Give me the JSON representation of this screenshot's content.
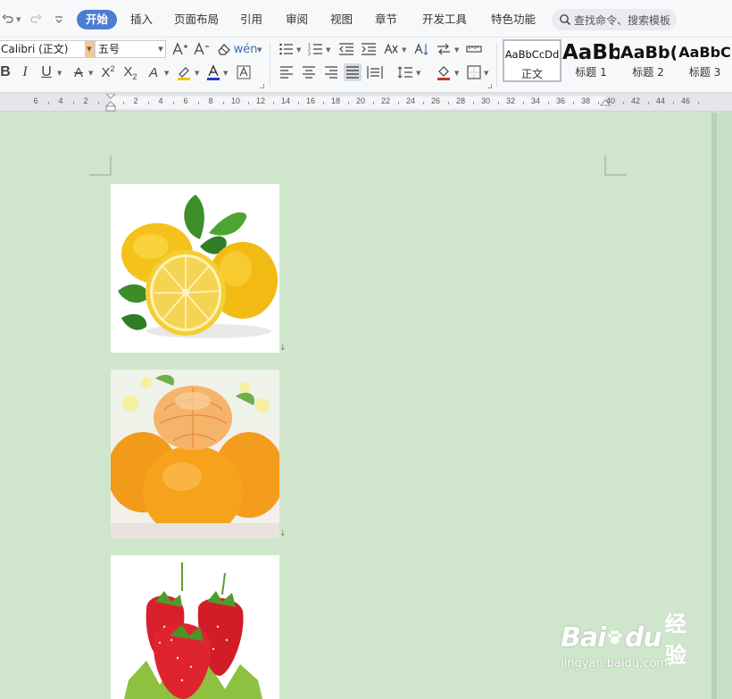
{
  "quick_access": {
    "undo_icon": "undo-icon",
    "redo_icon": "redo-icon",
    "customize_icon": "customize-icon"
  },
  "tabs": [
    {
      "label": "开始",
      "active": true
    },
    {
      "label": "插入"
    },
    {
      "label": "页面布局"
    },
    {
      "label": "引用"
    },
    {
      "label": "审阅"
    },
    {
      "label": "视图"
    },
    {
      "label": "章节"
    },
    {
      "label": "开发工具"
    },
    {
      "label": "特色功能"
    }
  ],
  "search": {
    "label": "查找命令、搜索模板"
  },
  "ribbon": {
    "font_name": "Calibri (正文)",
    "font_size": "五号",
    "styles": [
      {
        "preview": "AaBbCcDd",
        "name": "正文"
      },
      {
        "preview": "AaBb",
        "name": "标题 1"
      },
      {
        "preview": "AaBb(",
        "name": "标题 2"
      },
      {
        "preview": "AaBbC",
        "name": "标题 3"
      }
    ]
  },
  "ruler": {
    "labels": [
      "6",
      "4",
      "2",
      "2",
      "4",
      "6",
      "8",
      "10",
      "12",
      "14",
      "16",
      "18",
      "20",
      "22",
      "24",
      "26",
      "28",
      "30",
      "32",
      "34",
      "36",
      "38",
      "40",
      "42",
      "44",
      "46"
    ]
  },
  "document": {
    "images": [
      {
        "name": "lemon-image",
        "subject": "lemons"
      },
      {
        "name": "orange-image",
        "subject": "oranges"
      },
      {
        "name": "strawberry-image",
        "subject": "strawberries"
      }
    ]
  },
  "watermark": {
    "brand": "Bai",
    "brand2": "du",
    "cn": "经验",
    "url": "jingyan.baidu.com"
  },
  "colors": {
    "accent": "#4b7ed0",
    "page_background": "#cfe6cc",
    "highlight_icon": "#f2c200",
    "font_color_icon": "#1c3fd0"
  }
}
